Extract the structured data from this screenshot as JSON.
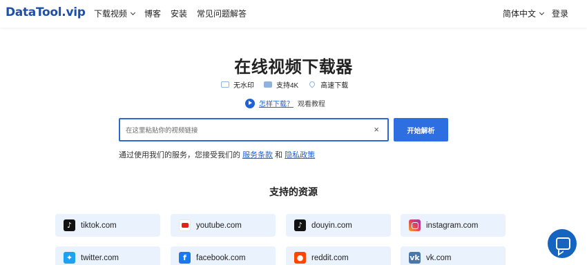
{
  "header": {
    "logo": "DataTool.vip",
    "nav": [
      {
        "label": "下载视频",
        "has_dropdown": true
      },
      {
        "label": "博客"
      },
      {
        "label": "安装"
      },
      {
        "label": "常见问题解答"
      }
    ],
    "language": "简体中文",
    "login": "登录"
  },
  "hero": {
    "title": "在线视频下载器",
    "features": [
      {
        "icon": "no-watermark-icon",
        "label": "无水印"
      },
      {
        "icon": "4k-icon",
        "label": "支持4K"
      },
      {
        "icon": "rocket-icon",
        "label": "高速下载"
      }
    ],
    "howto_link": "怎样下载？",
    "howto_text": "观看教程"
  },
  "search": {
    "placeholder": "在这里粘贴你的视频链接",
    "clear_glyph": "×",
    "button_label": "开始解析"
  },
  "terms": {
    "prefix": "通过使用我们的服务，您接受我们的",
    "service_link": "服务条款",
    "and": "和",
    "privacy_link": "隐私政策"
  },
  "sources": {
    "title": "支持的资源",
    "items": [
      {
        "label": "tiktok.com",
        "icon": "tiktok-icon"
      },
      {
        "label": "youtube.com",
        "icon": "youtube-icon"
      },
      {
        "label": "douyin.com",
        "icon": "douyin-icon"
      },
      {
        "label": "instagram.com",
        "icon": "instagram-icon"
      },
      {
        "label": "twitter.com",
        "icon": "twitter-icon"
      },
      {
        "label": "facebook.com",
        "icon": "facebook-icon"
      },
      {
        "label": "reddit.com",
        "icon": "reddit-icon"
      },
      {
        "label": "vk.com",
        "icon": "vk-icon"
      }
    ]
  },
  "colors": {
    "brand": "#1f4fa8",
    "primary": "#2d6fe0",
    "card_bg": "#eaf2fd"
  }
}
